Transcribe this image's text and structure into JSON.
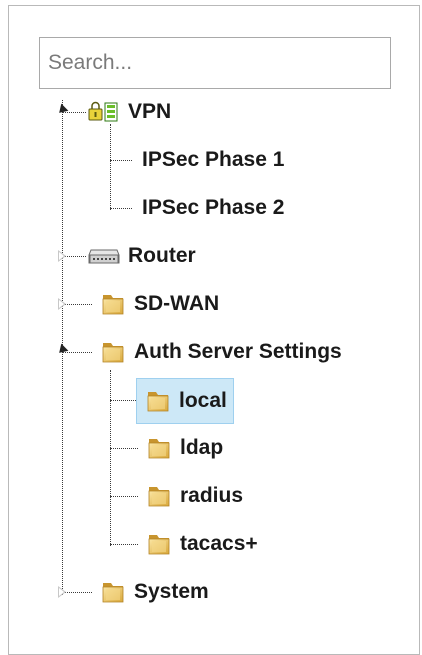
{
  "search": {
    "placeholder": "Search..."
  },
  "tree": {
    "vpn": {
      "label": "VPN",
      "icon": "vpn-lock-icon",
      "expanded": true,
      "children": [
        {
          "label": "IPSec Phase 1"
        },
        {
          "label": "IPSec Phase 2"
        }
      ]
    },
    "router": {
      "label": "Router",
      "icon": "router-icon",
      "expanded": false
    },
    "sdwan": {
      "label": "SD-WAN",
      "icon": "folder-icon",
      "expanded": false
    },
    "auth": {
      "label": "Auth Server Settings",
      "icon": "folder-icon",
      "expanded": true,
      "children": [
        {
          "label": "local",
          "selected": true
        },
        {
          "label": "ldap"
        },
        {
          "label": "radius"
        },
        {
          "label": "tacacs+"
        }
      ]
    },
    "system": {
      "label": "System",
      "icon": "folder-icon",
      "expanded": false
    }
  },
  "colors": {
    "selection": "#cde8f7",
    "folder": "#e8c15a",
    "vpn_icon": "#6bbf2a"
  }
}
